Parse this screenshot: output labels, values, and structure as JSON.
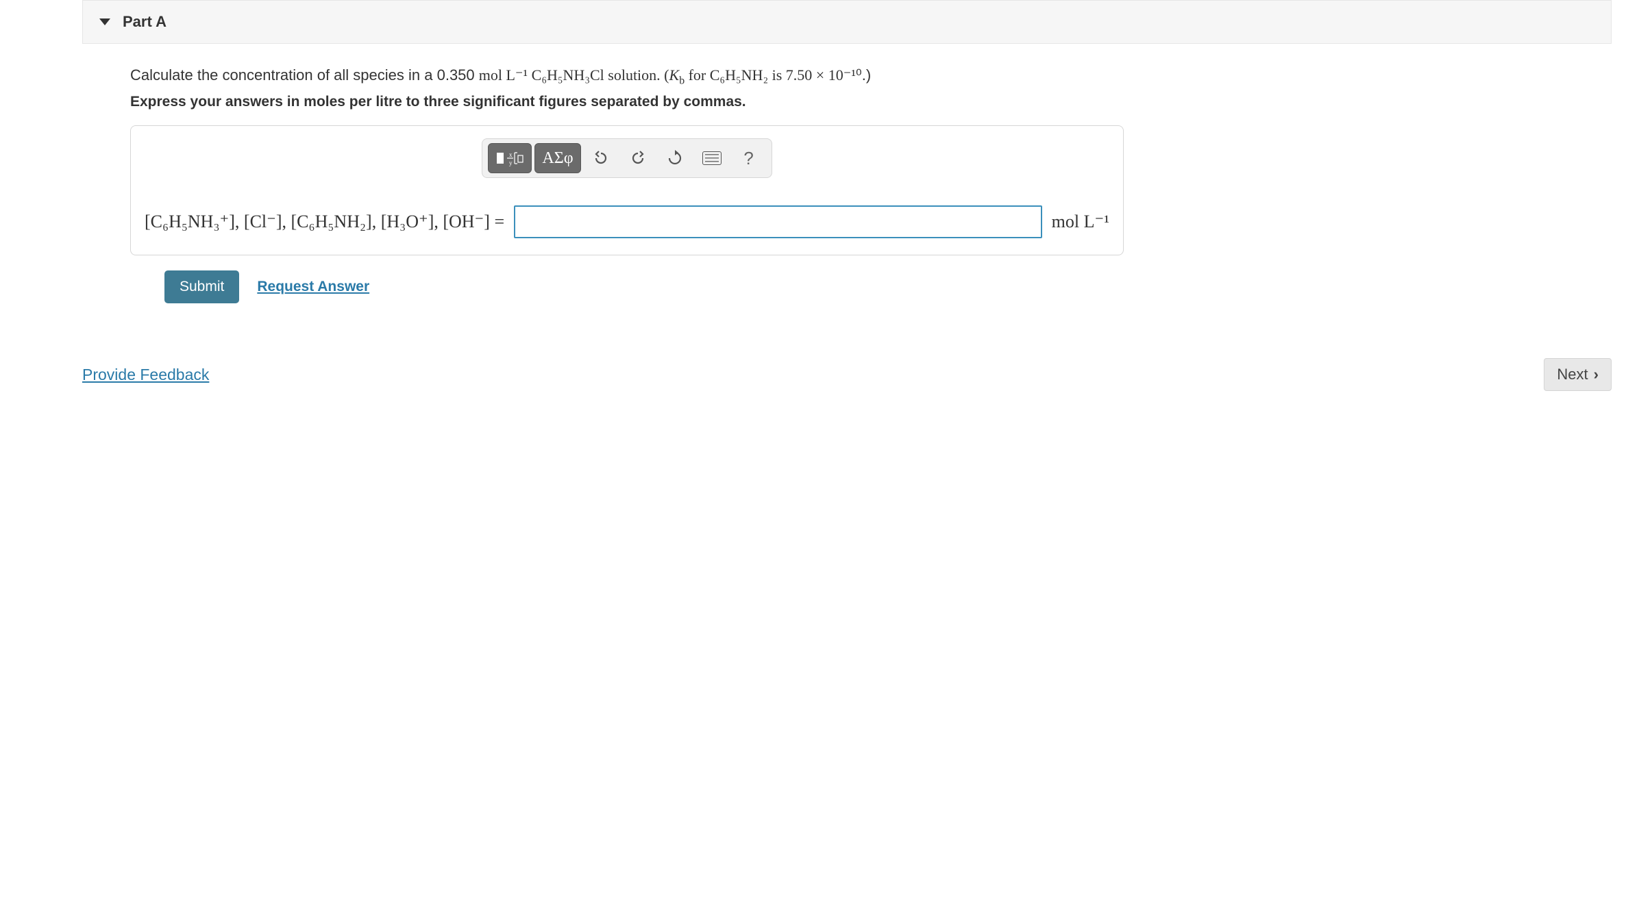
{
  "part": {
    "label": "Part A"
  },
  "question": {
    "pre": "Calculate the concentration of all species in a 0.350 ",
    "conc_unit": "mol L⁻¹",
    "mid1": " C₆H₅NH₃Cl solution. (",
    "kb_var": "K",
    "kb_sub": "b",
    "mid2": " for C₆H₅NH₂ is ",
    "kb_val": "7.50 × 10⁻¹⁰",
    "post": ".)"
  },
  "instructions": "Express your answers in moles per litre to three significant figures separated by commas.",
  "toolbar": {
    "greek_label": "ΑΣφ",
    "help_label": "?"
  },
  "species_label": "[C₆H₅NH₃⁺], [Cl⁻], [C₆H₅NH₂], [H₃O⁺], [OH⁻] =",
  "unit_label": "mol L⁻¹",
  "answer_value": "",
  "buttons": {
    "submit": "Submit",
    "request_answer": "Request Answer",
    "next": "Next"
  },
  "footer": {
    "feedback": "Provide Feedback"
  }
}
